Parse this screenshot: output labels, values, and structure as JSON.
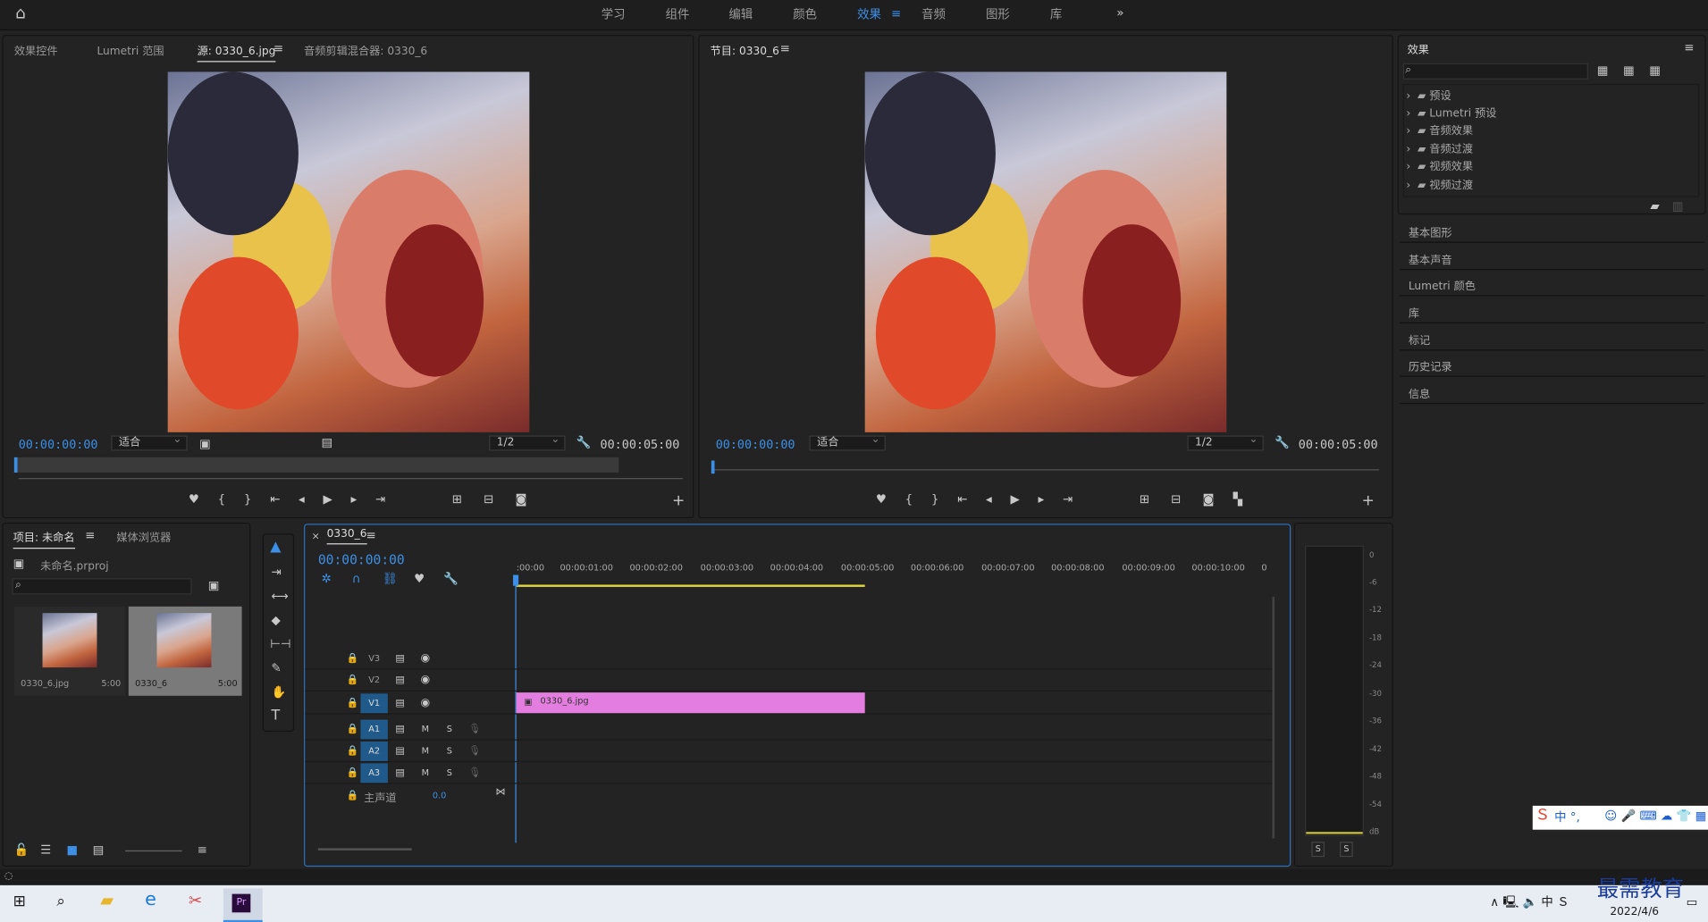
{
  "workspaces": [
    "学习",
    "组件",
    "编辑",
    "颜色",
    "效果",
    "音频",
    "图形",
    "库"
  ],
  "workspace_active": "效果",
  "source": {
    "tabs": [
      "效果控件",
      "Lumetri 范围",
      "源: 0330_6.jpg",
      "音频剪辑混合器: 0330_6"
    ],
    "timecode_in": "00:00:00:00",
    "fit": "适合",
    "res": "1/2",
    "timecode_out": "00:00:05:00"
  },
  "program": {
    "title": "节目: 0330_6",
    "timecode_in": "00:00:00:00",
    "fit": "适合",
    "res": "1/2",
    "timecode_out": "00:00:05:00"
  },
  "effects": {
    "title": "效果",
    "folders": [
      "预设",
      "Lumetri 预设",
      "音频效果",
      "音频过渡",
      "视频效果",
      "视频过渡"
    ]
  },
  "side_panels": [
    "基本图形",
    "基本声音",
    "Lumetri 颜色",
    "库",
    "标记",
    "历史记录",
    "信息"
  ],
  "project": {
    "tabs": [
      "项目: 未命名",
      "媒体浏览器"
    ],
    "file": "未命名.prproj",
    "items": [
      {
        "name": "0330_6.jpg",
        "dur": "5:00"
      },
      {
        "name": "0330_6",
        "dur": "5:00"
      }
    ]
  },
  "timeline": {
    "tab": "0330_6",
    "timecode": "00:00:00:00",
    "ruler": [
      ":00:00",
      "00:00:01:00",
      "00:00:02:00",
      "00:00:03:00",
      "00:00:04:00",
      "00:00:05:00",
      "00:00:06:00",
      "00:00:07:00",
      "00:00:08:00",
      "00:00:09:00",
      "00:00:10:00",
      "0"
    ],
    "video_tracks": [
      "V3",
      "V2",
      "V1"
    ],
    "audio_tracks": [
      "A1",
      "A2",
      "A3"
    ],
    "master": "主声道",
    "master_val": "0.0",
    "clip": "0330_6.jpg",
    "m": "M",
    "s": "S"
  },
  "meter": {
    "labels": [
      "0",
      "-6",
      "-12",
      "-18",
      "-24",
      "-30",
      "-36",
      "-42",
      "-48",
      "-54",
      "dB"
    ],
    "s": "S"
  },
  "ime": {
    "text": "中 °,"
  },
  "tray": {
    "date": "2022/4/6",
    "watermark": "最需教育"
  },
  "colors": {
    "accent": "#3d8fe6",
    "clip": "#e37ee0",
    "playhead": "#3d8fe6"
  }
}
